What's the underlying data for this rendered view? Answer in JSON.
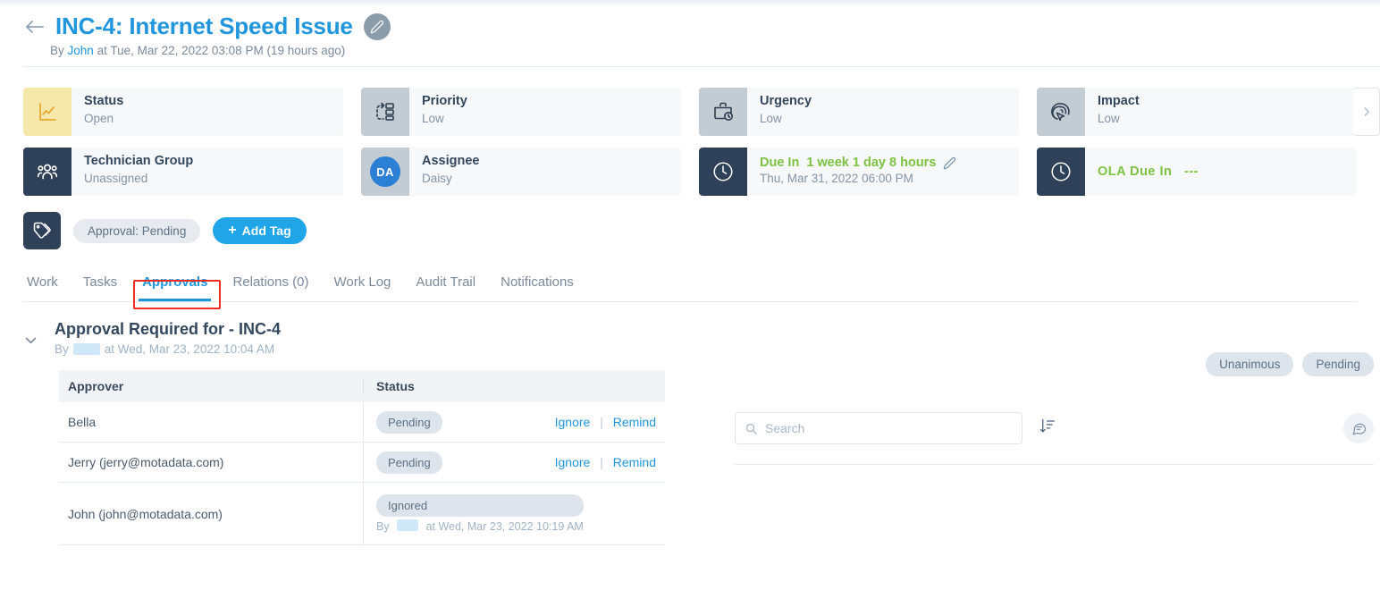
{
  "header": {
    "back_icon": "arrow-left-icon",
    "title": "INC-4: Internet Speed Issue",
    "edit_icon": "pencil-icon",
    "by_prefix": "By",
    "author": "John",
    "meta": "at Tue, Mar 22, 2022 03:08 PM (19 hours ago)"
  },
  "cards": {
    "row1": [
      {
        "icon": "chart-line-icon",
        "label": "Status",
        "value": "Open",
        "icon_style": "yellow"
      },
      {
        "icon": "priority-flow-icon",
        "label": "Priority",
        "value": "Low",
        "icon_style": "gray"
      },
      {
        "icon": "briefcase-clock-icon",
        "label": "Urgency",
        "value": "Low",
        "icon_style": "gray"
      },
      {
        "icon": "impact-target-icon",
        "label": "Impact",
        "value": "Low",
        "icon_style": "gray"
      }
    ],
    "row2": {
      "technician_group": {
        "icon": "users-group-icon",
        "label": "Technician Group",
        "value": "Unassigned"
      },
      "assignee": {
        "icon": "avatar-initials",
        "initials": "DA",
        "label": "Assignee",
        "value": "Daisy"
      },
      "due_in": {
        "icon": "clock-icon",
        "label": "Due In",
        "value": "1 week 1 day 8 hours",
        "edit_icon": "pencil-icon",
        "sub": "Thu, Mar 31, 2022 06:00 PM"
      },
      "ola_due_in": {
        "icon": "clock-icon",
        "label": "OLA Due In",
        "value": "---"
      }
    },
    "scroll_next_icon": "chevron-right-icon"
  },
  "tags": {
    "icon": "tags-icon",
    "chips": [
      "Approval: Pending"
    ],
    "add_label": "Add Tag",
    "add_icon": "plus-icon"
  },
  "tabs": [
    {
      "label": "Work",
      "active": false
    },
    {
      "label": "Tasks",
      "active": false
    },
    {
      "label": "Approvals",
      "active": true
    },
    {
      "label": "Relations (0)",
      "active": false
    },
    {
      "label": "Work Log",
      "active": false
    },
    {
      "label": "Audit Trail",
      "active": false
    },
    {
      "label": "Notifications",
      "active": false
    }
  ],
  "approval": {
    "collapse_icon": "chevron-down-icon",
    "title": "Approval Required for - INC-4",
    "by_prefix": "By",
    "by_name_redacted": true,
    "by_meta": "at Wed, Mar 23, 2022 10:04 AM",
    "badges": [
      "Unanimous",
      "Pending"
    ],
    "table": {
      "columns": [
        "Approver",
        "Status"
      ],
      "rows": [
        {
          "approver": "Bella",
          "status": "Pending",
          "by_line": "",
          "actions": [
            "Ignore",
            "Remind"
          ]
        },
        {
          "approver": "Jerry (jerry@motadata.com)",
          "status": "Pending",
          "by_line": "",
          "actions": [
            "Ignore",
            "Remind"
          ]
        },
        {
          "approver": "John (john@motadata.com)",
          "status": "Ignored",
          "by_prefix": "By",
          "by_meta": "at Wed, Mar 23, 2022 10:19 AM",
          "actions": []
        }
      ],
      "action_separator": "|"
    }
  },
  "right_pane": {
    "search_placeholder": "Search",
    "search_value": "",
    "search_icon": "search-icon",
    "sort_icon": "sort-descending-icon",
    "comment_icon": "comment-bubble-icon"
  },
  "colors": {
    "accent_blue": "#2196dd",
    "green": "#7dc242",
    "yellow_icon_bg": "#f6e7ab",
    "dark_navy": "#2f4158",
    "annotation_red": "#ee2d24"
  }
}
